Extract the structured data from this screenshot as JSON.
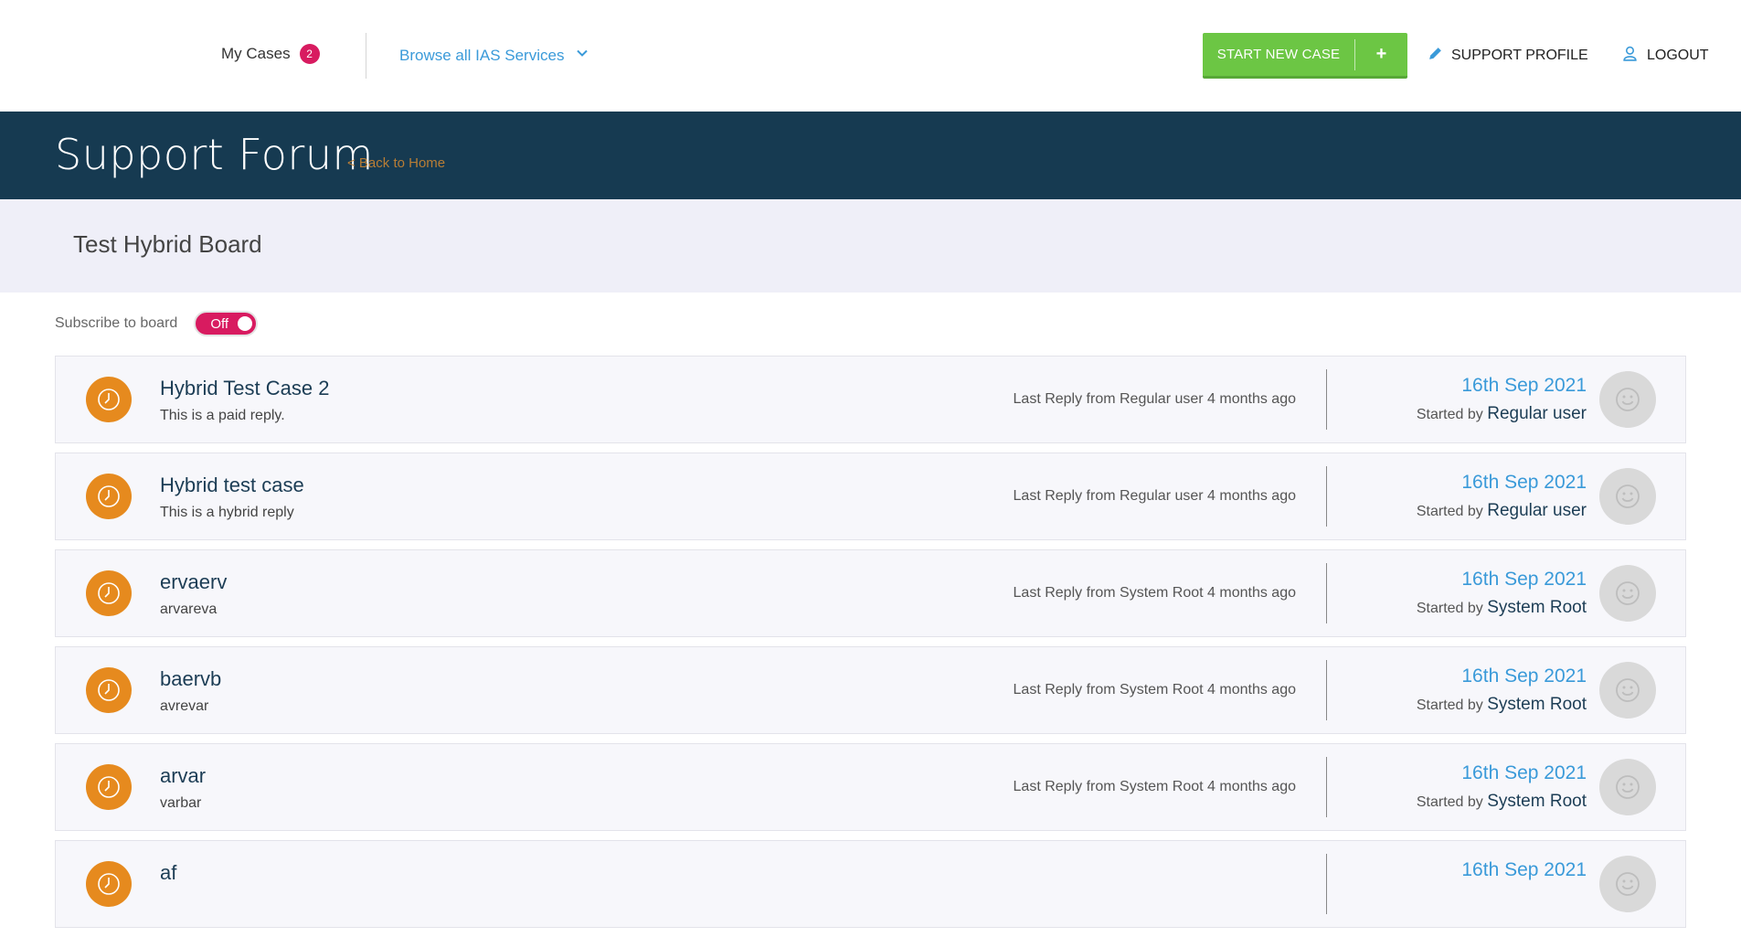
{
  "nav": {
    "my_cases_label": "My Cases",
    "my_cases_count": "2",
    "browse_label": "Browse all IAS Services",
    "start_new_case_label": "START NEW CASE",
    "start_new_case_plus": "+",
    "support_profile_label": "SUPPORT PROFILE",
    "logout_label": "LOGOUT"
  },
  "banner": {
    "title": "Support Forum",
    "back_link": "< Back to Home"
  },
  "board": {
    "name": "Test Hybrid Board",
    "subscribe_label": "Subscribe to board",
    "subscribe_state": "Off"
  },
  "threads": [
    {
      "title": "Hybrid Test Case 2",
      "subtitle": "This is a paid reply.",
      "last_reply": "Last Reply from Regular user 4 months ago",
      "date": "16th Sep 2021",
      "started_prefix": "Started by",
      "started_by": "Regular user"
    },
    {
      "title": "Hybrid test case",
      "subtitle": "This is a hybrid reply",
      "last_reply": "Last Reply from Regular user 4 months ago",
      "date": "16th Sep 2021",
      "started_prefix": "Started by",
      "started_by": "Regular user"
    },
    {
      "title": "ervaerv",
      "subtitle": "arvareva",
      "last_reply": "Last Reply from System Root 4 months ago",
      "date": "16th Sep 2021",
      "started_prefix": "Started by",
      "started_by": "System Root"
    },
    {
      "title": "baervb",
      "subtitle": "avrevar",
      "last_reply": "Last Reply from System Root 4 months ago",
      "date": "16th Sep 2021",
      "started_prefix": "Started by",
      "started_by": "System Root"
    },
    {
      "title": "arvar",
      "subtitle": "varbar",
      "last_reply": "Last Reply from System Root 4 months ago",
      "date": "16th Sep 2021",
      "started_prefix": "Started by",
      "started_by": "System Root"
    },
    {
      "title": "af",
      "subtitle": "",
      "last_reply": "",
      "date": "16th Sep 2021",
      "started_prefix": "",
      "started_by": ""
    }
  ],
  "colors": {
    "banner_bg": "#163a51",
    "accent_blue": "#3a9ad9",
    "start_button_green": "#6cc644",
    "badge_pink": "#d81b60",
    "status_orange": "#e68a1e"
  },
  "icons": {
    "browse": "chevron-down-icon",
    "support_profile": "pencil-icon",
    "logout": "user-icon",
    "thread_status": "clock-icon",
    "avatar": "smiley-icon"
  }
}
